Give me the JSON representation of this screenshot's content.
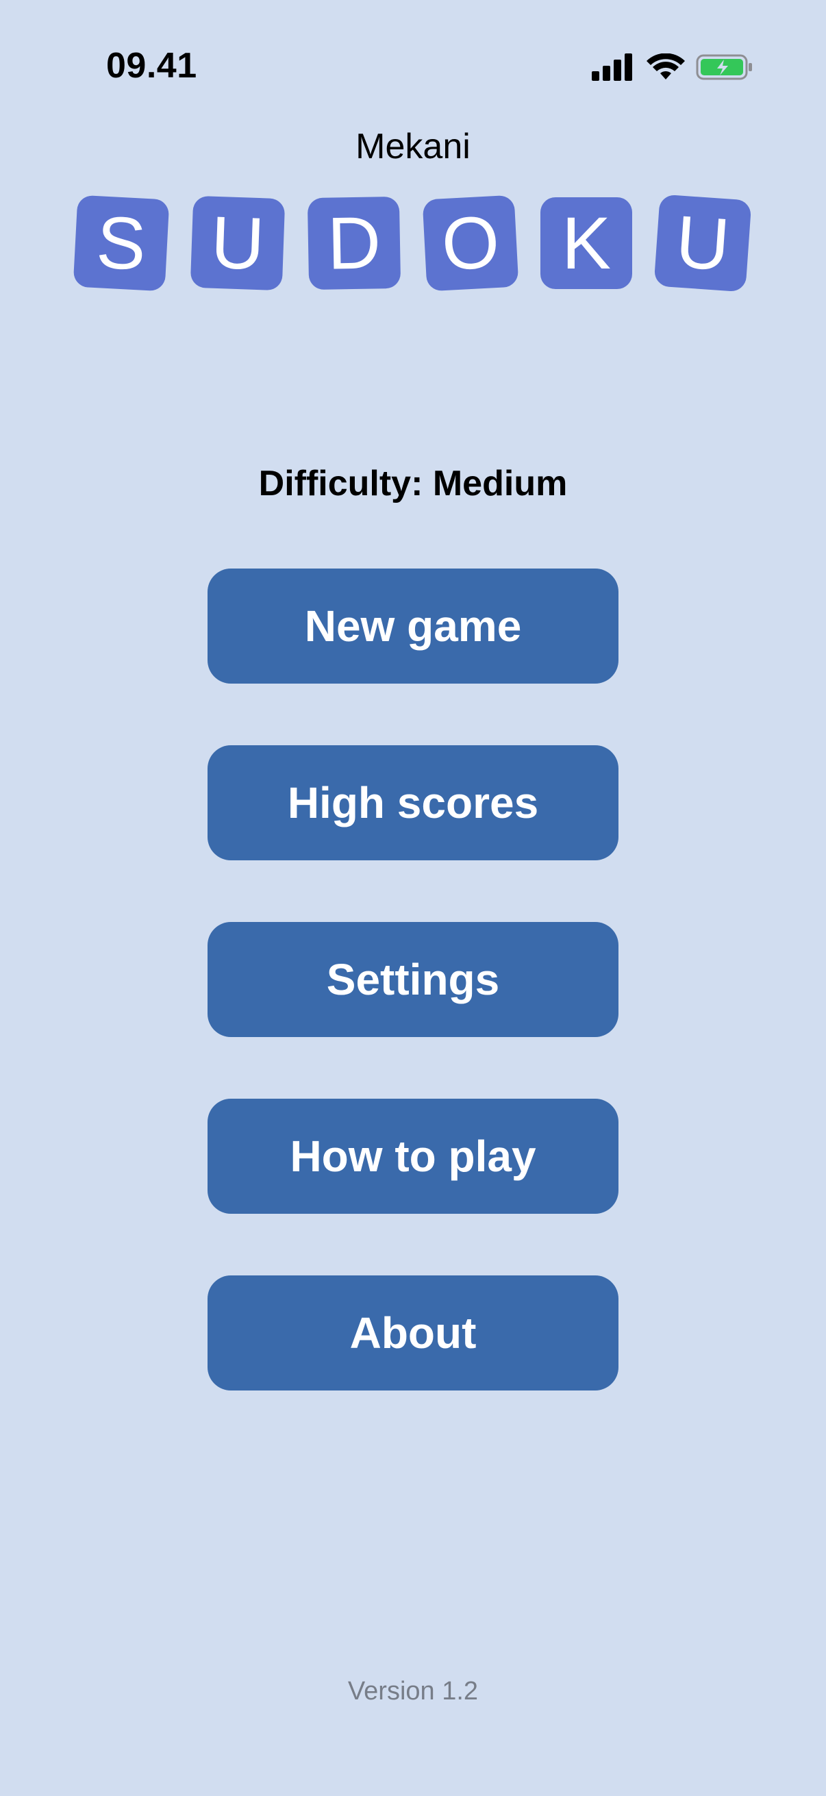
{
  "status_bar": {
    "time": "09.41",
    "signal_icon": "cellular-signal-icon",
    "wifi_icon": "wifi-icon",
    "battery_icon": "battery-charging-icon",
    "battery_color": "#34c759"
  },
  "app": {
    "brand": "Mekani",
    "logo_letters": [
      "S",
      "U",
      "D",
      "O",
      "K",
      "U"
    ],
    "logo_tile_color": "#5c73d0"
  },
  "difficulty": "Difficulty: Medium",
  "menu": {
    "button_color": "#3a6aab",
    "items": [
      {
        "label": "New game"
      },
      {
        "label": "High scores"
      },
      {
        "label": "Settings"
      },
      {
        "label": "How to play"
      },
      {
        "label": "About"
      }
    ]
  },
  "version": "Version 1.2",
  "background_color": "#d1ddf0"
}
